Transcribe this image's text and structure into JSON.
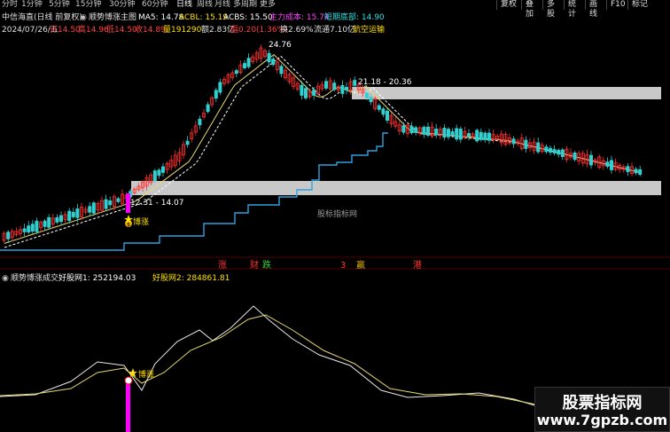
{
  "toolbar": {
    "periods": [
      "分时",
      "1分钟",
      "5分钟",
      "15分钟",
      "30分钟",
      "60分钟",
      "日线",
      "周线",
      "月线",
      "多周期",
      "更多"
    ],
    "active": "日线",
    "right_buttons": [
      "复权",
      "叠加",
      "多股",
      "统计",
      "画线",
      "F10",
      "标记"
    ]
  },
  "main": {
    "stock": "中信海直(日线 前复权)",
    "indicator_name": "顺势博涨主图",
    "ma5": "MA5: 14.78",
    "acbl": "ACBL: 15.19",
    "acbs": "ACBS: 15.50",
    "cost": "主力成本: 15.74",
    "bottom": "短期底部: 14.90",
    "date": "2024/07/26/五",
    "open": "开14.50",
    "high": "高14.96",
    "low": "低14.50",
    "close": "收14.89",
    "volume": "量191290",
    "amount": "额2.83亿",
    "change": "幅0.20(1.36%)",
    "turnover": "换2.69%",
    "float_cap": "流通7.10亿",
    "sector": "航空运输",
    "peak_label": "24.76",
    "zone_upper": "21.18 - 20.36",
    "zone_lower": "12.31 - 14.07",
    "signal": "博涨",
    "center_watermark": "股标指标网",
    "markers": [
      {
        "text": "涨",
        "color": "#ff3030"
      },
      {
        "text": "财",
        "color": "#ff3030"
      },
      {
        "text": "跌",
        "color": "#30d030"
      },
      {
        "text": "3",
        "color": "#ff3030"
      },
      {
        "text": "赢",
        "color": "#e0b000"
      },
      {
        "text": "港",
        "color": "#ff3030"
      }
    ]
  },
  "sub": {
    "title": "顺势博涨成交",
    "val1": "好股网1: 252194.03",
    "val2": "好股网2: 284861.81",
    "signal": "博涨"
  },
  "watermark": {
    "line1": "股票指标网",
    "line2": "www.7gpzb.com"
  },
  "colors": {
    "up": "#ff3030",
    "down": "#30d0d0",
    "ma": "#e8d870",
    "dash": "#ffffff",
    "step": "#30a0e0",
    "zone": "#c8c8c8",
    "bar": "#ff00ff"
  }
}
